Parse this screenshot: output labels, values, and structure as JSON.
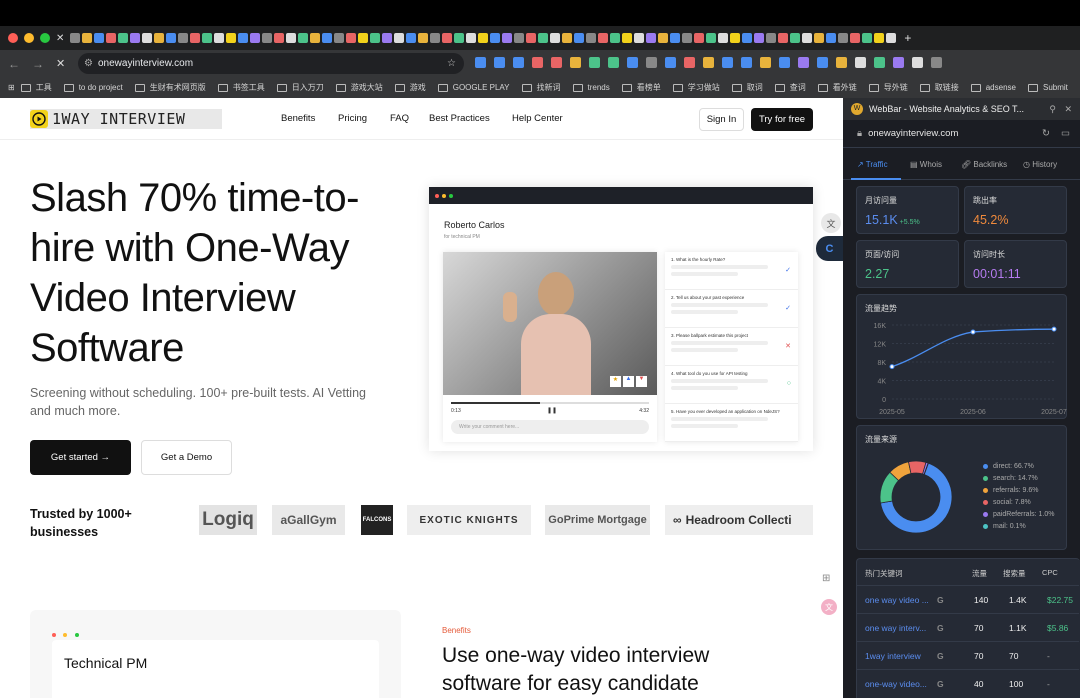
{
  "browser": {
    "url": "onewayinterview.com",
    "bookmarks": [
      "工具",
      "to do project",
      "生财有术网页版",
      "书签工具",
      "日入万刀",
      "游戏大站",
      "游戏",
      "GOOGLE PLAY",
      "找新词",
      "trends",
      "看榜单",
      "学习做站",
      "取词",
      "查词",
      "看外链",
      "导外链",
      "取链接",
      "adsense",
      "Submit"
    ]
  },
  "site": {
    "logo": "1WAY INTERVIEW",
    "nav": [
      "Benefits",
      "Pricing",
      "FAQ",
      "Best Practices",
      "Help Center"
    ],
    "sign_in": "Sign In",
    "try_free": "Try for free",
    "hero_title": "Slash 70% time-to-hire with One-Way Video Interview Software",
    "hero_sub": "Screening without scheduling. 100+ pre-built tests. AI Vetting and much more.",
    "get_started": "Get started →",
    "get_demo": "Get a Demo",
    "trusted": "Trusted by 1000+ businesses",
    "logos": [
      "Logiq",
      "aGallGym",
      "FALCONS",
      "EXOTIC KNIGHTS",
      "GoPrime Mortgage",
      "Headroom Collecti"
    ],
    "preview": {
      "name": "Roberto Carlos",
      "role": "for technical PM",
      "time_start": "0:13",
      "time_end": "4:32",
      "comment_placeholder": "Write your comment here...",
      "questions": [
        "1. What is the hourly Rate?",
        "2. Tell us about your past experience",
        "3. Please ballpark estimate this project",
        "4. What tool do you use for API testing",
        "5. Have you ever developed an application on NdeJS?"
      ]
    },
    "benefits_tag": "Benefits",
    "section_title": "Use one-way video interview software for easy candidate",
    "card_title": "Technical PM"
  },
  "webbar": {
    "title": "WebBar - Website Analytics & SEO T...",
    "domain": "onewayinterview.com",
    "tabs": [
      "Traffic",
      "Whois",
      "Backlinks",
      "History"
    ],
    "metrics": [
      {
        "label": "月访问量",
        "value": "15.1K",
        "delta": "+5.5%",
        "color": "#5b8def"
      },
      {
        "label": "跳出率",
        "value": "45.2%",
        "color": "#f08a3c"
      },
      {
        "label": "页面/访问",
        "value": "2.27",
        "color": "#4cc38a"
      },
      {
        "label": "访问时长",
        "value": "00:01:11",
        "color": "#b57bf0"
      }
    ],
    "trend_title": "流量趋势",
    "source_title": "流量来源",
    "sources": [
      {
        "label": "direct: 66.7%",
        "color": "#4a8df0"
      },
      {
        "label": "search: 14.7%",
        "color": "#4cc38a"
      },
      {
        "label": "referrals: 9.6%",
        "color": "#f0a33c"
      },
      {
        "label": "social: 7.8%",
        "color": "#e86565"
      },
      {
        "label": "paidReferrals: 1.0%",
        "color": "#9a7af0"
      },
      {
        "label": "mail: 0.1%",
        "color": "#4cc3c3"
      }
    ],
    "kw_header": [
      "热门关键词",
      "流量",
      "搜索量",
      "CPC"
    ],
    "keywords": [
      {
        "kw": "one way video ...",
        "traffic": "140",
        "volume": "1.4K",
        "cpc": "$22.75"
      },
      {
        "kw": "one way interv...",
        "traffic": "70",
        "volume": "1.1K",
        "cpc": "$5.86"
      },
      {
        "kw": "1way interview",
        "traffic": "70",
        "volume": "70",
        "cpc": "-"
      },
      {
        "kw": "one-way video...",
        "traffic": "40",
        "volume": "100",
        "cpc": "-"
      }
    ]
  },
  "chart_data": {
    "type": "line",
    "title": "流量趋势",
    "categories": [
      "2025-05",
      "2025-06",
      "2025-07"
    ],
    "x": [
      "2025-05",
      "2025-06",
      "2025-07"
    ],
    "values": [
      7000,
      14500,
      15100
    ],
    "ylim": [
      0,
      16000
    ],
    "yticks": [
      "16K",
      "12K",
      "8K",
      "4K",
      "0"
    ],
    "xlabel": "",
    "ylabel": ""
  }
}
